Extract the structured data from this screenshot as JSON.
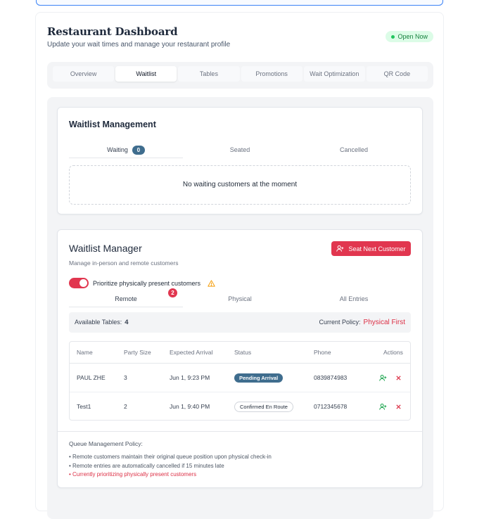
{
  "header": {
    "title": "Restaurant Dashboard",
    "subtitle": "Update your wait times and manage your restaurant profile",
    "status_badge": "Open Now"
  },
  "tabs": [
    {
      "label": "Overview"
    },
    {
      "label": "Waitlist"
    },
    {
      "label": "Tables"
    },
    {
      "label": "Promotions"
    },
    {
      "label": "Wait Optimization"
    },
    {
      "label": "QR Code"
    }
  ],
  "waitlist_management": {
    "title": "Waitlist Management",
    "tabs": [
      {
        "label": "Waiting",
        "count": "0"
      },
      {
        "label": "Seated"
      },
      {
        "label": "Cancelled"
      }
    ],
    "empty_message": "No waiting customers at the moment"
  },
  "waitlist_manager": {
    "title": "Waitlist Manager",
    "subtitle": "Manage in-person and remote customers",
    "seat_button": "Seat Next Customer",
    "toggle_label": "Prioritize physically present customers",
    "source_tabs": [
      {
        "label": "Remote",
        "badge": "2"
      },
      {
        "label": "Physical"
      },
      {
        "label": "All Entries"
      }
    ],
    "available_tables_label": "Available Tables:",
    "available_tables_value": "4",
    "current_policy_label": "Current Policy:",
    "current_policy_value": "Physical First",
    "columns": [
      "Name",
      "Party Size",
      "Expected Arrival",
      "Status",
      "Phone",
      "Actions"
    ],
    "rows": [
      {
        "name": "PAUL ZHE",
        "party": "3",
        "arrival": "Jun 1, 9:23 PM",
        "status": "Pending Arrival",
        "phone": "0839874983"
      },
      {
        "name": "Test1",
        "party": "2",
        "arrival": "Jun 1, 9:40 PM",
        "status": "Confirmed En Route",
        "phone": "0712345678"
      }
    ],
    "policy_heading": "Queue Management Policy:",
    "policy_lines": [
      "• Remote customers maintain their original queue position upon physical check-in",
      "• Remote entries are automatically cancelled if 15 minutes late",
      "• Currently prioritizing physically present customers"
    ]
  },
  "colors": {
    "accent_red": "#e1364f",
    "badge_blue": "#3f6d8e",
    "open_green": "#22c55e"
  }
}
